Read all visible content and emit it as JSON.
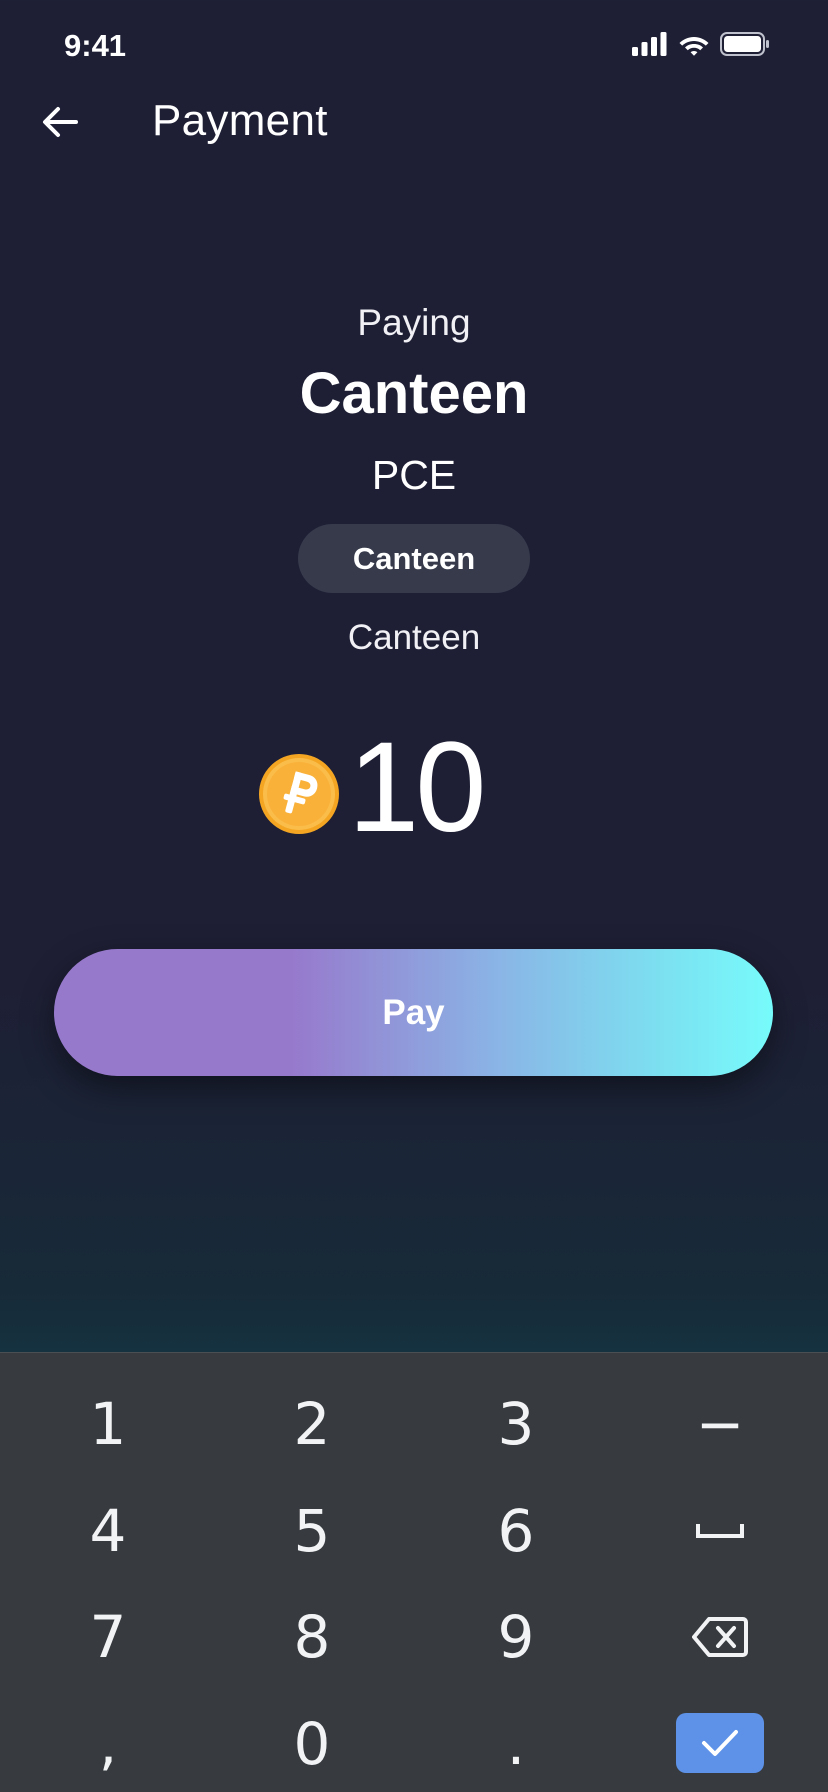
{
  "status_bar": {
    "time": "9:41"
  },
  "header": {
    "title": "Payment"
  },
  "payment": {
    "paying_label": "Paying",
    "merchant_name": "Canteen",
    "merchant_code": "PCE",
    "tag": "Canteen",
    "category": "Canteen",
    "amount": "10",
    "currency_icon": "coin-icon"
  },
  "pay_button": {
    "label": "Pay"
  },
  "keyboard": {
    "row1": [
      "1",
      "2",
      "3",
      "−"
    ],
    "row2": [
      "4",
      "5",
      "6"
    ],
    "row3": [
      "7",
      "8",
      "9"
    ],
    "row4": [
      ",",
      "0",
      "."
    ],
    "special_icons": [
      "space-icon",
      "backspace-icon",
      "checkmark-icon"
    ]
  },
  "colors": {
    "background": "#1e1f35",
    "chip": "#363a4b",
    "pay_gradient_start": "#9779cc",
    "pay_gradient_end": "#77fbfb",
    "coin": "#f7b23b",
    "keyboard_bg": "#373b3f",
    "enter_key": "#5d92e8"
  }
}
